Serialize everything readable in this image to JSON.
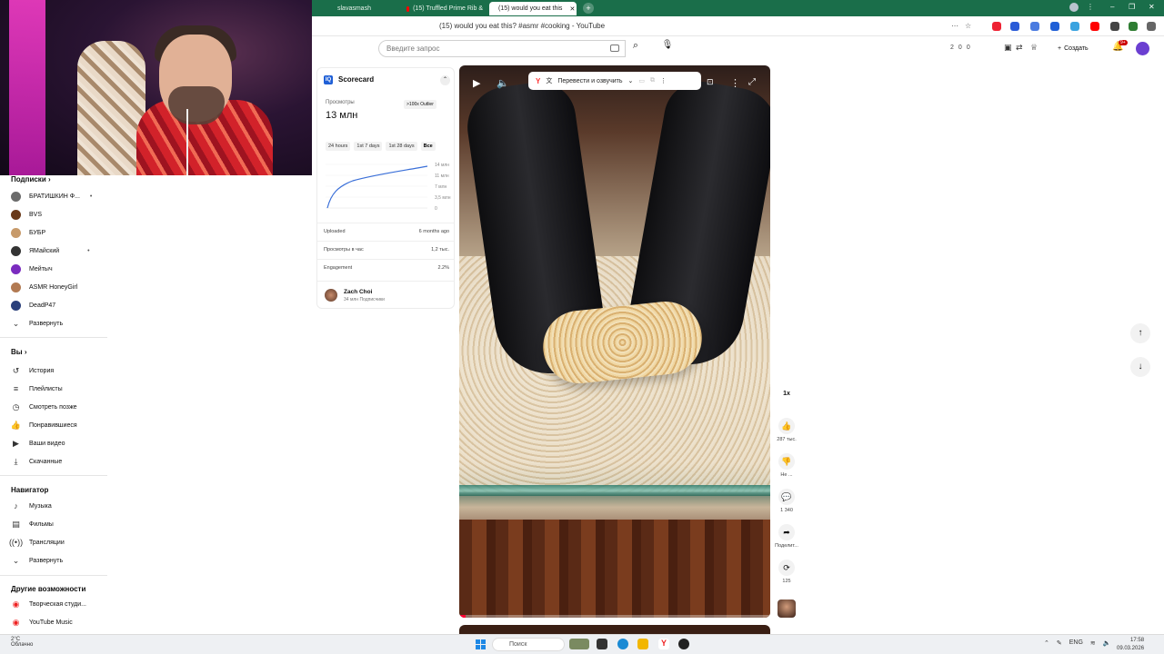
{
  "browser": {
    "tabs": [
      {
        "label": "slavasmash"
      },
      {
        "label": "(15) Truffled Prime Rib &"
      },
      {
        "label": "(15) would you eat this"
      }
    ],
    "page_title": "(15) would you eat this? #asmr #cooking - YouTube"
  },
  "header": {
    "search_placeholder": "Введите запрос",
    "stats": [
      "2",
      "0",
      "0"
    ],
    "create_label": "Создать",
    "notification_count": "9+"
  },
  "sidebar": {
    "subscriptions_title": "Подписки",
    "subscriptions": [
      {
        "label": "БРАТИШКИН Ф...",
        "color": "#6b6b6b",
        "dot": "•"
      },
      {
        "label": "BVS",
        "color": "#6a3a1a",
        "dot": ""
      },
      {
        "label": "БУБР",
        "color": "#c79a6a",
        "dot": ""
      },
      {
        "label": "ЯМайский",
        "color": "#333333",
        "dot": "•"
      },
      {
        "label": "Мейтыч",
        "color": "#7b2cbf",
        "dot": ""
      },
      {
        "label": "ASMR HoneyGirl",
        "color": "#b27a52",
        "dot": ""
      },
      {
        "label": "DeadP47",
        "color": "#2a3f7a",
        "dot": ""
      }
    ],
    "expand_label": "Развернуть",
    "you_title": "Вы",
    "you_items": [
      {
        "label": "История",
        "icon": "history-icon"
      },
      {
        "label": "Плейлисты",
        "icon": "playlist-icon"
      },
      {
        "label": "Смотреть позже",
        "icon": "clock-icon"
      },
      {
        "label": "Понравившиеся",
        "icon": "like-icon"
      },
      {
        "label": "Ваши видео",
        "icon": "video-icon"
      },
      {
        "label": "Скачанные",
        "icon": "download-icon"
      }
    ],
    "navigator_title": "Навигатор",
    "navigator_items": [
      {
        "label": "Музыка",
        "icon": "music-icon"
      },
      {
        "label": "Фильмы",
        "icon": "film-icon"
      },
      {
        "label": "Трансляции",
        "icon": "live-icon"
      }
    ],
    "navigator_expand_label": "Развернуть",
    "other_title": "Другие возможности",
    "other_items": [
      {
        "label": "Творческая студи...",
        "icon": "studio-icon"
      },
      {
        "label": "YouTube Music",
        "icon": "yt-music-icon"
      }
    ]
  },
  "scorecard": {
    "title": "Scorecard",
    "views_label": "Просмотры",
    "views_value": "13 млн",
    "outlier_label": ">100x Outlier",
    "tabs": [
      "24 hours",
      "1st 7 days",
      "1st 28 days",
      "Все"
    ],
    "selected_tab": "Все",
    "chart_axis": [
      "14 млн",
      "11 млн",
      "7 млн",
      "3,5 млн",
      "0"
    ],
    "rows": [
      {
        "label": "Uploaded",
        "value": "6 months ago"
      },
      {
        "label": "Просмотры в час",
        "value": "1,2 тыс."
      },
      {
        "label": "Engagement",
        "value": "2.2%"
      }
    ],
    "channel_name": "Zach Choi",
    "channel_subs": "34 млн Подписчики"
  },
  "player": {
    "translate_label": "Перевести и озвучить",
    "progress_fraction": 0.02
  },
  "actions": {
    "speed_label": "1x",
    "like_count": "287 тыс.",
    "dislike_label": "Не ...",
    "comments_count": "1 340",
    "share_label": "Поделит...",
    "remix_count": "125"
  },
  "taskbar": {
    "weather_temp": "2°C",
    "weather_text": "Облачно",
    "search_label": "Поиск",
    "lang": "ENG",
    "time": "17:58",
    "date": "09.03.2026"
  },
  "colors": {
    "tab_bar": "#1a6e4a",
    "accent": "#ff0033",
    "scorecard_blue": "#1f5fd6"
  }
}
